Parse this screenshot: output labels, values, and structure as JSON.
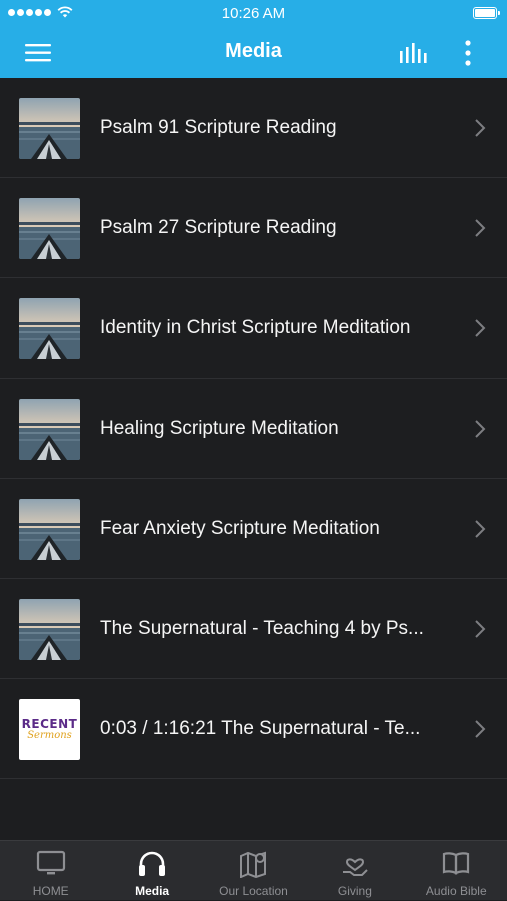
{
  "status_bar": {
    "time": "10:26 AM"
  },
  "nav": {
    "title": "Media"
  },
  "items": [
    {
      "label": "Psalm 91 Scripture Reading",
      "thumbnail": "ocean-kayak"
    },
    {
      "label": "Psalm 27 Scripture Reading",
      "thumbnail": "ocean-kayak"
    },
    {
      "label": "Identity in Christ Scripture Meditation",
      "thumbnail": "ocean-kayak"
    },
    {
      "label": "Healing Scripture Meditation",
      "thumbnail": "ocean-kayak"
    },
    {
      "label": "Fear Anxiety Scripture Meditation",
      "thumbnail": "ocean-kayak"
    },
    {
      "label": "The Supernatural - Teaching 4 by Ps...",
      "thumbnail": "ocean-kayak"
    },
    {
      "label": "0:03 / 1:16:21   The Supernatural - Te...",
      "thumbnail": "recent-sermons"
    }
  ],
  "recent_thumb": {
    "line1": "RECENT",
    "line2": "Sermons"
  },
  "tabs": [
    {
      "label": "HOME",
      "icon": "tv-icon",
      "active": false
    },
    {
      "label": "Media",
      "icon": "headphones-icon",
      "active": true
    },
    {
      "label": "Our Location",
      "icon": "map-pin-icon",
      "active": false
    },
    {
      "label": "Giving",
      "icon": "hand-heart-icon",
      "active": false
    },
    {
      "label": "Audio Bible",
      "icon": "book-icon",
      "active": false
    }
  ],
  "colors": {
    "accent": "#27aee7",
    "background": "#1d1e20",
    "tab_bar": "#2b2c2f"
  }
}
